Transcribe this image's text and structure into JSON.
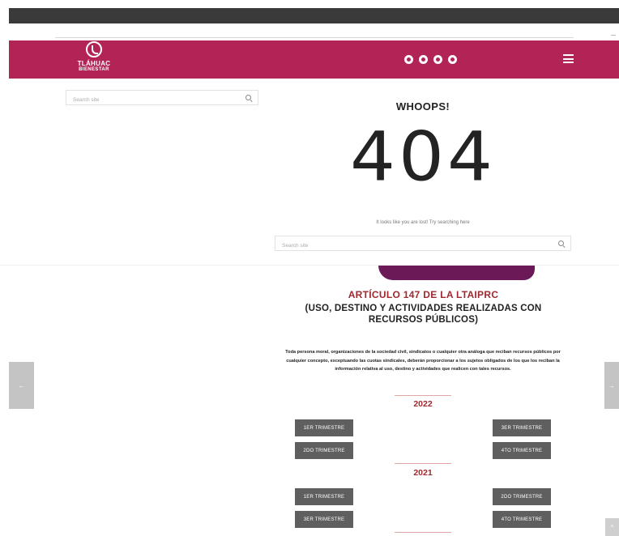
{
  "header": {
    "logo_name": "TLÁHUAC",
    "logo_sub": "BIENESTAR",
    "social_icons": [
      "facebook-icon",
      "twitter-icon",
      "instagram-icon",
      "youtube-icon"
    ],
    "accent_color": "#b22456"
  },
  "sidebar_search": {
    "placeholder": "Search site"
  },
  "error": {
    "heading": "WHOOPS!",
    "code": "404",
    "message": "It looks like you are lost! Try searching here",
    "search_placeholder": "Search site"
  },
  "article": {
    "title": "ARTÍCULO 147 DE LA LTAIPRC",
    "subtitle": "(USO, DESTINO Y ACTIVIDADES REALIZADAS CON RECURSOS PÚBLICOS)",
    "body": "Toda persona moral, organizaciones de la sociedad civil, sindicatos o cualquier otra análoga que reciban recursos públicos por cualquier concepto, exceptuando las cuotas sindicales, deberán proporcionar a los sujetos obligados de los que los reciban la información relativa al uso, destino y actividades que realicen con tales recursos."
  },
  "years": [
    {
      "year": "2022",
      "buttons": [
        "1ER TRIMESTRE",
        "3ER TRIMESTRE",
        "2DO TRIMESTRE",
        "4TO TRIMESTRE"
      ]
    },
    {
      "year": "2021",
      "buttons": [
        "1ER TRIMESTRE",
        "2DO TRIMESTRE",
        "3ER TRIMESTRE",
        "4TO TRIMESTRE"
      ]
    }
  ],
  "nav": {
    "prev_arrow": "←",
    "next_arrow": "→",
    "scroll_top": "^"
  }
}
